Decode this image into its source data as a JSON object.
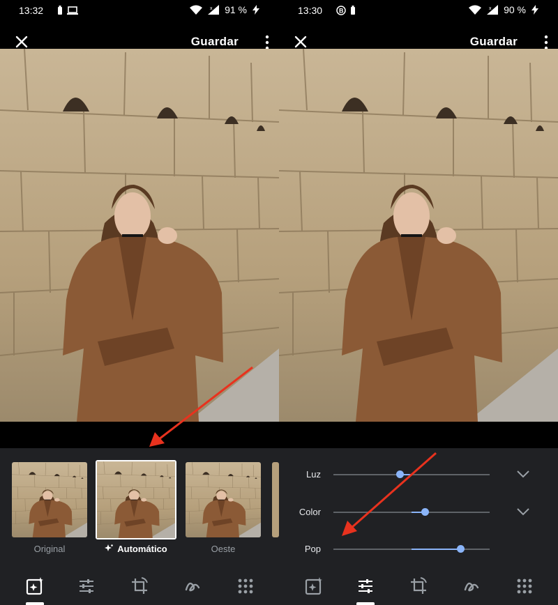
{
  "left_screen": {
    "status": {
      "time": "13:32",
      "battery": "91 %"
    },
    "header": {
      "save_label": "Guardar"
    },
    "filters": [
      {
        "label": "Original",
        "selected": false
      },
      {
        "label": "Automático",
        "selected": true
      },
      {
        "label": "Oeste",
        "selected": false
      }
    ],
    "active_tool": "suggestions"
  },
  "right_screen": {
    "status": {
      "time": "13:30",
      "battery": "90 %"
    },
    "header": {
      "save_label": "Guardar"
    },
    "adjustments": [
      {
        "label": "Luz",
        "value": -0.15,
        "expandable": true
      },
      {
        "label": "Color",
        "value": 0.17,
        "expandable": true
      },
      {
        "label": "Pop",
        "value": 0.63,
        "expandable": false
      }
    ],
    "active_tool": "adjust"
  },
  "tools": [
    "suggestions-icon",
    "adjust-sliders-icon",
    "crop-rotate-icon",
    "markup-icon",
    "more-tools-icon"
  ],
  "colors": {
    "accent": "#8ab4f8",
    "panel_bg": "#202124",
    "annotation_arrow": "#e8321e"
  }
}
